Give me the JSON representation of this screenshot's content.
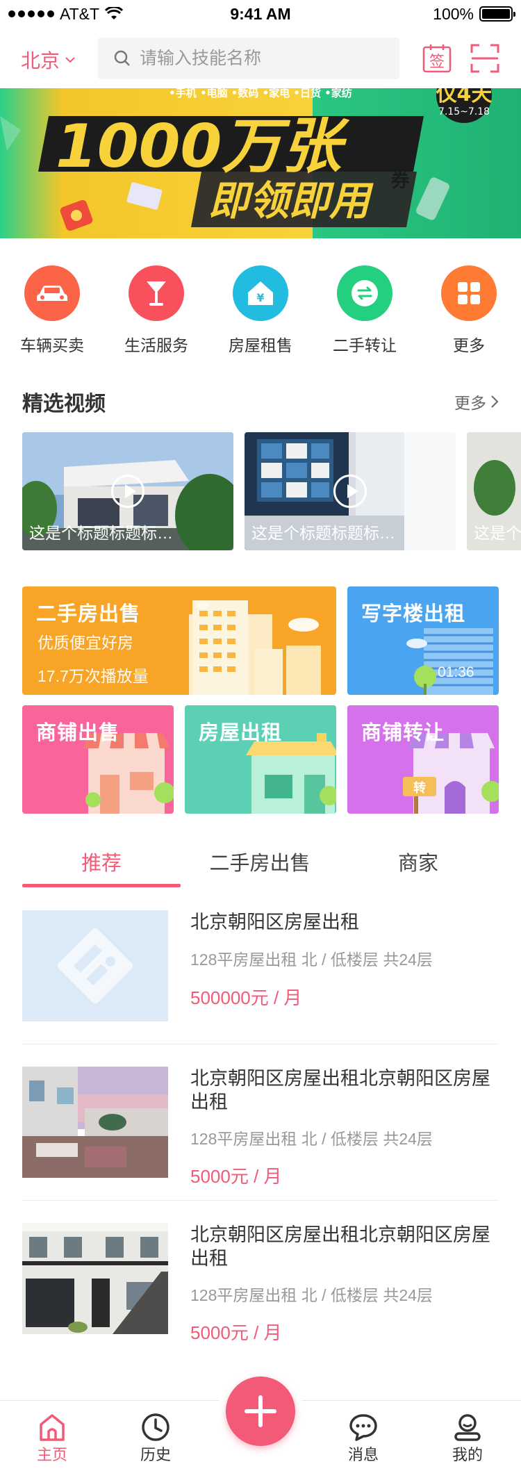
{
  "status_bar": {
    "carrier": "AT&T",
    "time": "9:41 AM",
    "battery": "100%"
  },
  "header": {
    "city": "北京",
    "search_placeholder": "请输入技能名称",
    "sign_label": "签"
  },
  "banner": {
    "categories": "•手机 •电脑 •数码 •家电 •日货 •家纺",
    "headline": "1000万张",
    "coupon_label": "优惠券",
    "days": "仅4天",
    "dates": "7.15~7.18",
    "cta": "即领即用"
  },
  "categories": [
    {
      "label": "车辆买卖",
      "color": "#fb6447",
      "icon": "car-icon"
    },
    {
      "label": "生活服务",
      "color": "#f8515b",
      "icon": "cocktail-icon"
    },
    {
      "label": "房屋租售",
      "color": "#22bce0",
      "icon": "house-yuan-icon"
    },
    {
      "label": "二手转让",
      "color": "#24cf7f",
      "icon": "exchange-icon"
    },
    {
      "label": "更多",
      "color": "#ff7a32",
      "icon": "grid-icon"
    }
  ],
  "featured_videos": {
    "title": "精选视频",
    "more": "更多",
    "items": [
      {
        "title": "这是个标题标题标…"
      },
      {
        "title": "这是个标题标题标…"
      },
      {
        "title": "这是个"
      }
    ]
  },
  "property_tiles": {
    "second_hand": {
      "title": "二手房出售",
      "subtitle": "优质便宜好房",
      "plays": "17.7万次播放量",
      "color": "#f8a527"
    },
    "office": {
      "title": "写字楼出租",
      "time": "01:36",
      "color": "#4aa4f0"
    },
    "shop_sale": {
      "title": "商铺出售",
      "color": "#f9649a"
    },
    "rent": {
      "title": "房屋出租",
      "color": "#5cd0b5"
    },
    "shop_transfer": {
      "title": "商铺转让",
      "badge": "转",
      "color": "#d671ec"
    }
  },
  "tabs": [
    {
      "label": "推荐",
      "active": true
    },
    {
      "label": "二手房出售",
      "active": false
    },
    {
      "label": "商家",
      "active": false
    }
  ],
  "listings": [
    {
      "title": "北京朝阳区房屋出租",
      "meta": "128平房屋出租  北 / 低楼层  共24层",
      "price": "500000元 / 月",
      "image": "placeholder"
    },
    {
      "title": "北京朝阳区房屋出租北京朝阳区房屋出租",
      "meta": "128平房屋出租  北 / 低楼层  共24层",
      "price": "5000元 / 月",
      "image": "terrace"
    },
    {
      "title": "北京朝阳区房屋出租北京朝阳区房屋出租",
      "meta": "128平房屋出租  北 / 低楼层  共24层",
      "price": "5000元 / 月",
      "image": "townhouse"
    }
  ],
  "tabbar": [
    {
      "label": "主页",
      "icon": "home-icon",
      "active": true
    },
    {
      "label": "历史",
      "icon": "clock-icon",
      "active": false
    },
    {
      "label": "消息",
      "icon": "chat-icon",
      "active": false
    },
    {
      "label": "我的",
      "icon": "user-icon",
      "active": false
    }
  ],
  "accent_color": "#f25a78"
}
